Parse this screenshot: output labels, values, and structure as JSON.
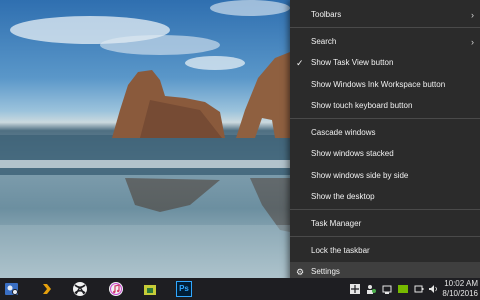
{
  "menu": {
    "items": [
      {
        "label": "Toolbars",
        "submenu": true
      },
      {
        "label": "Search",
        "submenu": true
      },
      {
        "label": "Show Task View button",
        "checked": true
      },
      {
        "label": "Show Windows Ink Workspace button"
      },
      {
        "label": "Show touch keyboard button"
      },
      {
        "label": "Cascade windows"
      },
      {
        "label": "Show windows stacked"
      },
      {
        "label": "Show windows side by side"
      },
      {
        "label": "Show the desktop"
      },
      {
        "label": "Task Manager"
      },
      {
        "label": "Lock the taskbar"
      },
      {
        "label": "Settings",
        "hovered": true
      }
    ],
    "arrow_glyph": "›",
    "check_glyph": "✓",
    "settings_glyph": "⚙"
  },
  "taskbar": {
    "ps_label": "Ps",
    "clock_time": "10:02 AM",
    "clock_date": "8/10/2016"
  },
  "colors": {
    "menu_bg": "#2b2b2b",
    "menu_hover": "#3f3f3f",
    "taskbar_bg": "#1e1e22",
    "accent": "#0078d7"
  }
}
